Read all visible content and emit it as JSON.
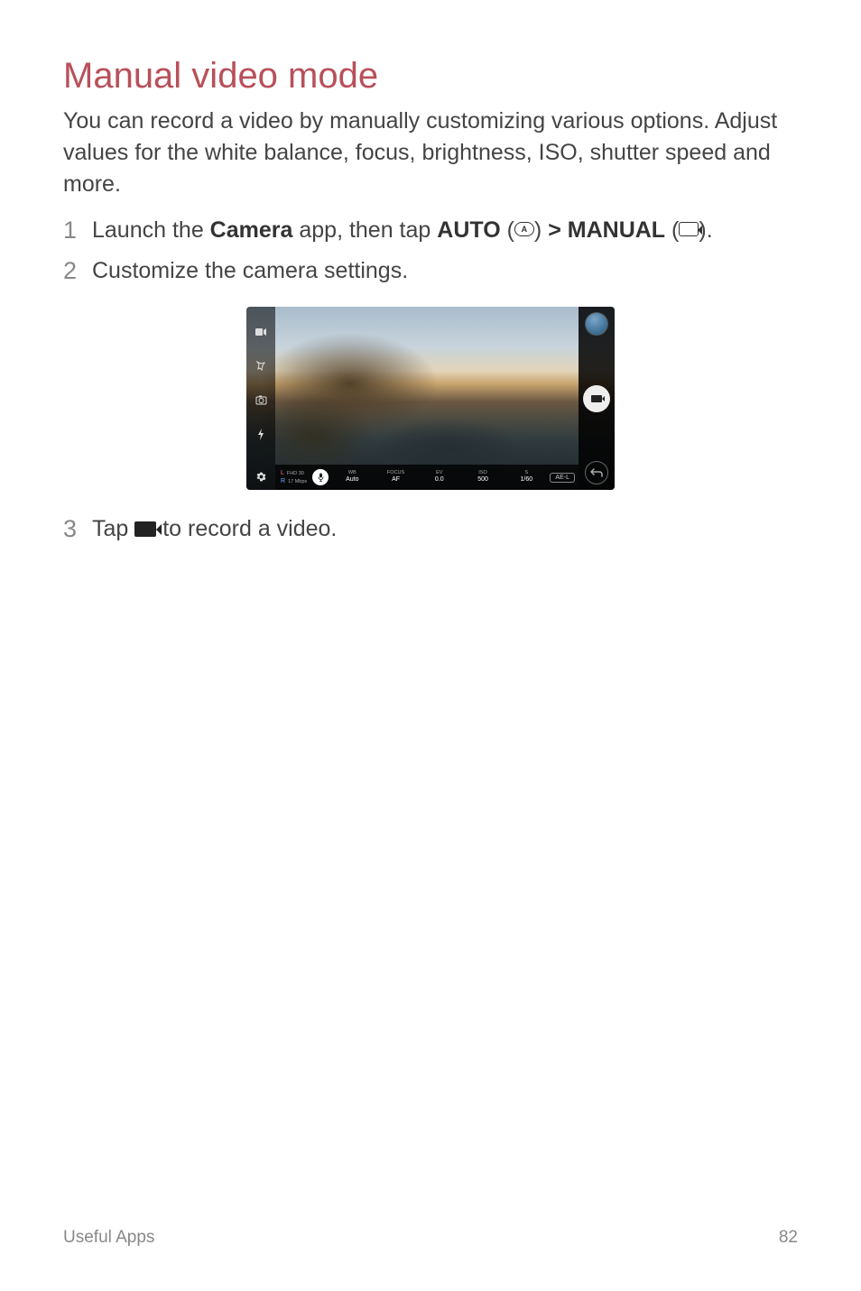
{
  "title": "Manual video mode",
  "intro": "You can record a video by manually customizing various options. Adjust values for the white balance, focus, brightness, ISO, shutter speed and more.",
  "steps": {
    "s1": {
      "num": "1",
      "part1": "Launch the ",
      "bold1": "Camera",
      "part2": " app, then tap ",
      "bold2": "AUTO",
      "part3": " (",
      "iconA": "A",
      "part4": ") ",
      "gt": ">",
      "part5": " ",
      "bold3": "MANUAL",
      "part6": " (",
      "part7": ")."
    },
    "s2": {
      "num": "2",
      "text": "Customize the camera settings."
    },
    "s3": {
      "num": "3",
      "part1": "Tap ",
      "part2": " to record a video."
    }
  },
  "camera_ui": {
    "params": {
      "res_line1": "L",
      "res_line2": "R",
      "res_val1": "FHD 30",
      "res_val2": "17 Mbps",
      "wb": {
        "label": "WB",
        "value": "Auto"
      },
      "focus": {
        "label": "FOCUS",
        "value": "AF"
      },
      "ev": {
        "label": "EV",
        "value": "0.0"
      },
      "iso": {
        "label": "ISO",
        "value": "500"
      },
      "shutter": {
        "label": "S",
        "value": "1/60"
      },
      "ael": "AE-L"
    }
  },
  "footer": {
    "section": "Useful Apps",
    "page": "82"
  }
}
